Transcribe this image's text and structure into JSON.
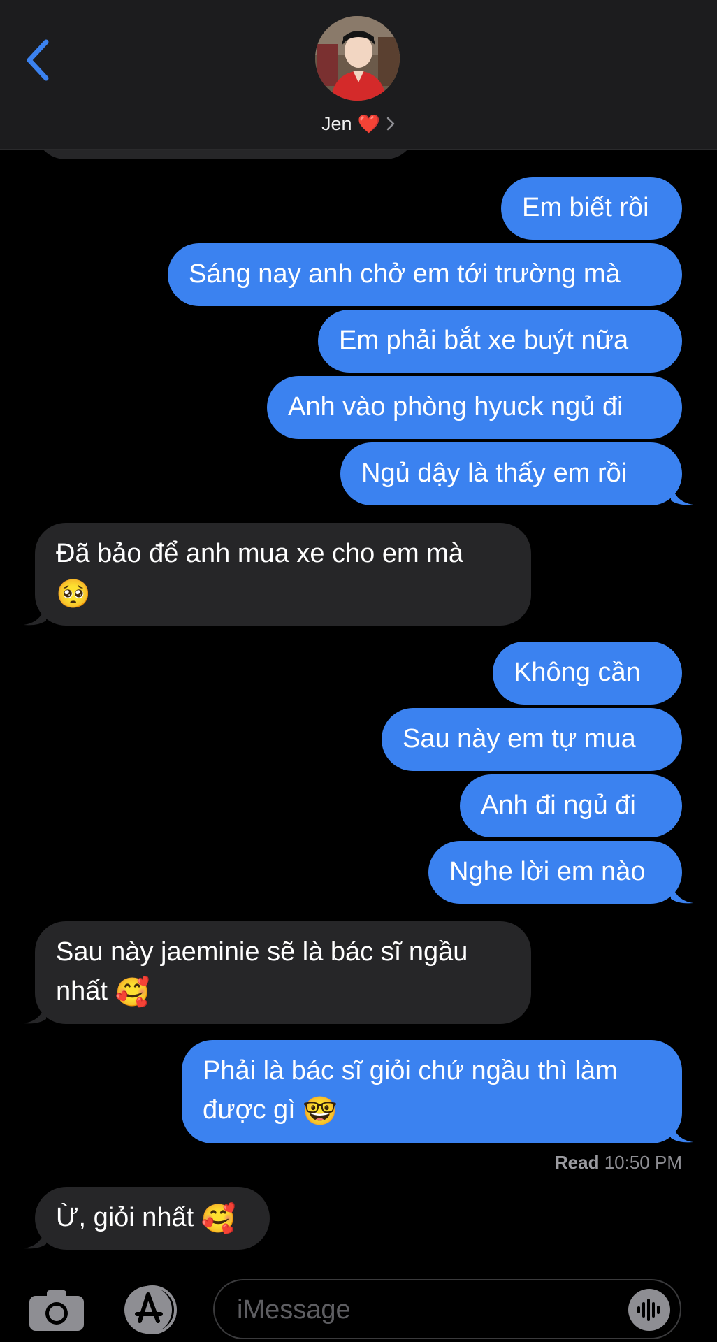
{
  "header": {
    "contact_name": "Jen",
    "contact_emoji": "❤️"
  },
  "messages": [
    {
      "from": "me",
      "text": "Em biết rồi"
    },
    {
      "from": "me",
      "text": "Sáng nay anh chở em tới trường mà"
    },
    {
      "from": "me",
      "text": "Em phải bắt xe buýt nữa"
    },
    {
      "from": "me",
      "text": "Anh vào phòng hyuck ngủ đi"
    },
    {
      "from": "me",
      "text": "Ngủ dậy là thấy em rồi"
    },
    {
      "from": "them",
      "line1": "Đã bảo để anh mua xe cho em mà",
      "emoji": "🥺"
    },
    {
      "from": "me",
      "text": "Không cần"
    },
    {
      "from": "me",
      "text": "Sau này em tự mua"
    },
    {
      "from": "me",
      "text": "Anh đi ngủ đi"
    },
    {
      "from": "me",
      "text": "Nghe lời em nào"
    },
    {
      "from": "them",
      "line1": "Sau này jaeminie sẽ là bác sĩ ngầu",
      "line2": "nhất",
      "emoji": "🥰"
    },
    {
      "from": "me",
      "line1": "Phải là bác sĩ giỏi chứ ngầu thì làm",
      "line2": "được gì",
      "emoji": "🤓"
    },
    {
      "from": "them",
      "line1": "Ừ, giỏi nhất",
      "emoji": "🥰"
    }
  ],
  "read_receipt": {
    "label": "Read",
    "time": "10:50 PM"
  },
  "input": {
    "placeholder": "iMessage"
  },
  "colors": {
    "outgoing": "#3b82f0",
    "incoming": "#262628",
    "accent": "#3b82f0"
  }
}
